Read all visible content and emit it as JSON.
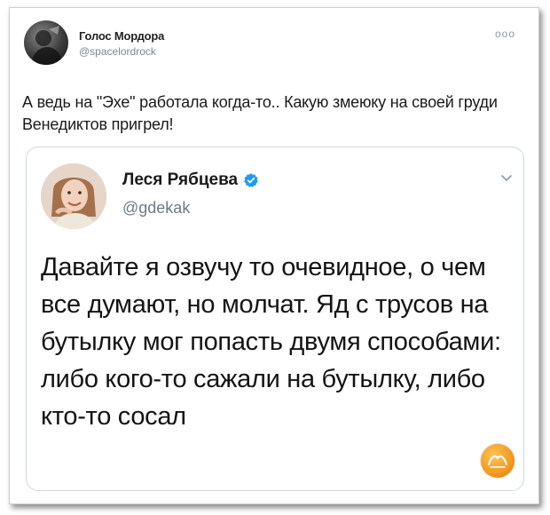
{
  "outer_tweet": {
    "author_name": "Голос Мордора",
    "author_handle": "@spacelordrock",
    "more_icon": "more-dots-icon",
    "text": "А ведь на \"Эхе\" работала когда-то.. Какую змеюку на своей груди Венедиктов пригрел!"
  },
  "quoted_tweet": {
    "author_name": "Леся Рябцева",
    "author_handle": "@gdekak",
    "verified": true,
    "verified_icon": "verified-badge-icon",
    "menu_icon": "chevron-down-icon",
    "text": "Давайте я озвучу то очевидное, о чем все думают, но молчат. Яд с трусов на бутылку мог попасть двумя способами: либо кого-то сажали на бутылку, либо кто-то сосал"
  },
  "colors": {
    "verified_blue": "#1d9bf0",
    "handle_gray": "#6b7a88",
    "card_border": "#cfd9de",
    "watermark_orange": "#f29a1f"
  }
}
